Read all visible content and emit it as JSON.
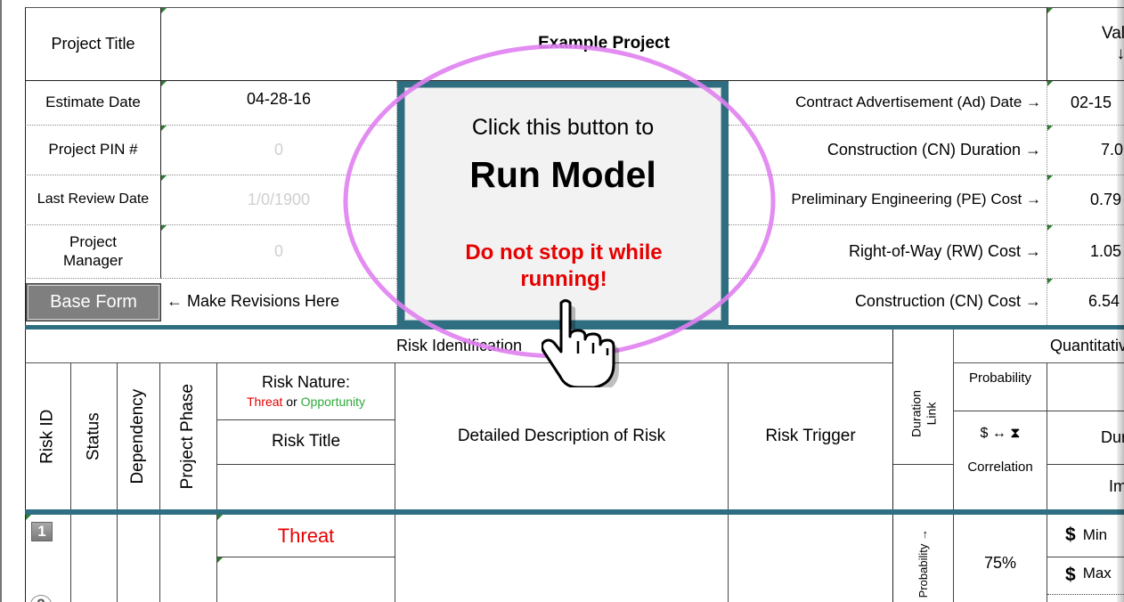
{
  "header": {
    "project_title_label": "Project Title",
    "project_title_value": "Example Project",
    "value_header": "Val",
    "value_arrow": "↓",
    "estimate_date_label": "Estimate Date",
    "estimate_date_value": "04-28-16",
    "pin_label": "Project PIN #",
    "pin_value": "0",
    "last_review_label": "Last Review Date",
    "last_review_value": "1/0/1900",
    "manager_label": "Project Manager",
    "manager_value": "0",
    "base_form_button": "Base Form",
    "make_revisions": "← Make Revisions Here"
  },
  "run_button": {
    "line1": "Click this button to",
    "line2": "Run Model",
    "warning": "Do not stop it while running!"
  },
  "right_params": [
    {
      "label": "Contract Advertisement (Ad) Date →",
      "value": "02-15"
    },
    {
      "label": "Construction (CN) Duration →",
      "value": "7.0"
    },
    {
      "label": "Preliminary Engineering (PE) Cost →",
      "value": "0.79"
    },
    {
      "label": "Right-of-Way (RW) Cost →",
      "value": "1.05"
    },
    {
      "label": "Construction (CN) Cost →",
      "value": "6.54"
    }
  ],
  "table": {
    "section_risk_identification": "Risk Identification",
    "section_quantitative": "Quantitativ",
    "col_risk_id": "Risk ID",
    "col_status": "Status",
    "col_dependency": "Dependency",
    "col_project_phase": "Project Phase",
    "risk_nature_label": "Risk Nature:",
    "threat_word": "Threat",
    "or_word": " or ",
    "opportunity_word": "Opportunity",
    "col_risk_title": "Risk Title",
    "col_detailed_description": "Detailed Description of Risk",
    "col_risk_trigger": "Risk Trigger",
    "col_duration_link": "Duration Link",
    "col_probability": "Probability",
    "col_correlation_symbol": "$ ↔ ⧗",
    "col_correlation": "Correlation",
    "col_duration_partial": "Dur",
    "col_impact_partial": "Im",
    "row1": {
      "id": "1",
      "nature": "Threat",
      "probability_label": "Probability →",
      "probability": "75%",
      "min_symbol": "$",
      "min_label": "Min",
      "max_symbol": "$",
      "max_label": "Max"
    },
    "row2_id_partial": "2"
  },
  "colors": {
    "frame_teal": "#2f6e80",
    "button_face": "#f2f2f2",
    "base_form_bg": "#7f7f7f",
    "threat": "#e60000",
    "opportunity": "#2eaa3a",
    "highlight_ring": "#e07ff0"
  },
  "icons": [
    "hand-pointer-icon",
    "highlight-ellipse"
  ]
}
